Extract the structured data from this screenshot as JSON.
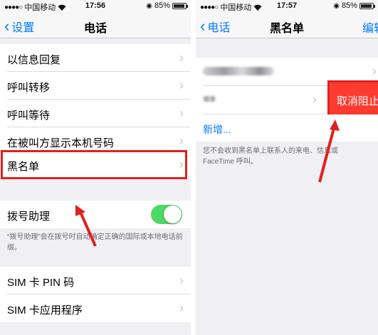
{
  "left": {
    "status": {
      "carrier": "中国移动",
      "time": "17:56",
      "battery": "85%",
      "battery_level": 0.85
    },
    "nav": {
      "back": "设置",
      "title": "电话"
    },
    "items": [
      {
        "label": "以信息回复"
      },
      {
        "label": "呼叫转移"
      },
      {
        "label": "呼叫等待"
      },
      {
        "label": "在被叫方显示本机号码"
      },
      {
        "label": "黑名单"
      },
      {
        "label": "拨号助理"
      },
      {
        "label": "SIM 卡 PIN 码"
      },
      {
        "label": "SIM 卡应用程序"
      }
    ],
    "dial_assist": {
      "enabled": true
    },
    "footnote": "“拨号助理”会在拨号时自动确定正确的国际或本地电话前缀。"
  },
  "right": {
    "status": {
      "carrier": "中国移动",
      "time": "17:57",
      "battery": "85%",
      "battery_level": 0.85
    },
    "nav": {
      "back": "电话",
      "title": "黑名单",
      "edit": "编辑"
    },
    "unblock": "取消阻止",
    "add": "新增...",
    "footnote": "您不会收到黑名单上联系人的来电、信息或 FaceTime 呼叫。"
  },
  "colors": {
    "accent": "#007aff",
    "toggle_on": "#4cd964",
    "destructive": "#ff3b30",
    "annotation": "#e02020"
  },
  "icons": [
    "wifi-icon",
    "chevron-right-icon",
    "chevron-left-icon",
    "battery-icon",
    "lock-rotation-icon"
  ]
}
